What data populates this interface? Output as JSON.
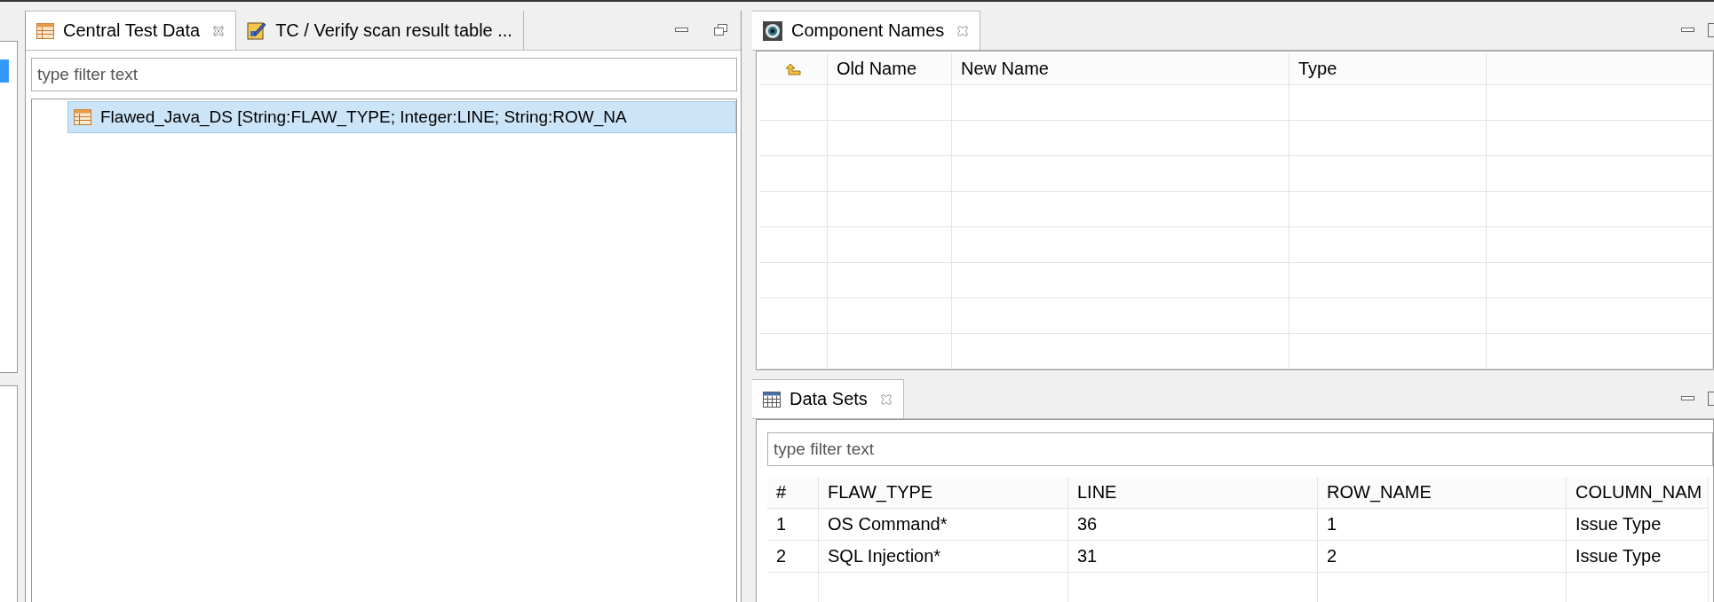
{
  "editor_area": {
    "tabs": [
      {
        "label": "Central Test Data",
        "selected": true,
        "closable": true
      },
      {
        "label": "TC / Verify scan result table ...",
        "selected": false,
        "closable": false
      }
    ],
    "filter": {
      "placeholder": "type filter text"
    },
    "tree": [
      {
        "label": "Flawed_Java_DS [String:FLAW_TYPE; Integer:LINE; String:ROW_NA",
        "selected": true
      }
    ]
  },
  "component_names": {
    "tab": {
      "label": "Component Names",
      "selected": true,
      "closable": true
    },
    "columns": [
      "Old Name",
      "New Name",
      "Type"
    ]
  },
  "data_sets": {
    "tab": {
      "label": "Data Sets",
      "selected": true,
      "closable": true
    },
    "filter": {
      "placeholder": "type filter text"
    },
    "columns": [
      "#",
      "FLAW_TYPE",
      "LINE",
      "ROW_NAME",
      "COLUMN_NAM"
    ],
    "rows": [
      [
        "1",
        "OS Command*",
        "36",
        "1",
        "Issue Type"
      ],
      [
        "2",
        "SQL Injection*",
        "31",
        "2",
        "Issue Type"
      ]
    ]
  }
}
